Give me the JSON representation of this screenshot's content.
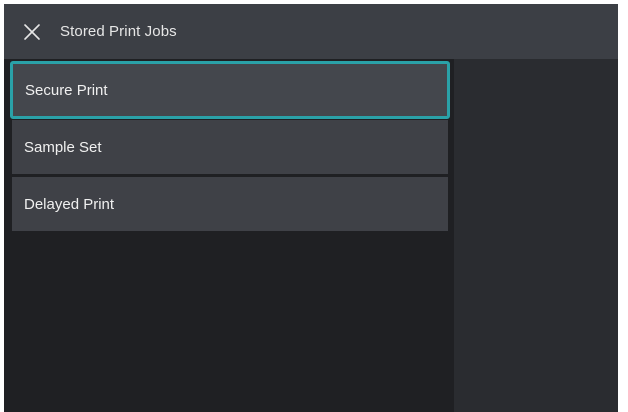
{
  "header": {
    "close_icon": "close-icon",
    "title": "Stored Print Jobs"
  },
  "list": {
    "items": [
      {
        "label": "Secure Print",
        "selected": true
      },
      {
        "label": "Sample Set",
        "selected": false
      },
      {
        "label": "Delayed Print",
        "selected": false
      }
    ]
  },
  "colors": {
    "header_bg": "#3c3f45",
    "screen_bg": "#1f2023",
    "item_bg": "#3f4147",
    "focus_border": "#2aa1a8",
    "text": "#f0f0f0"
  }
}
